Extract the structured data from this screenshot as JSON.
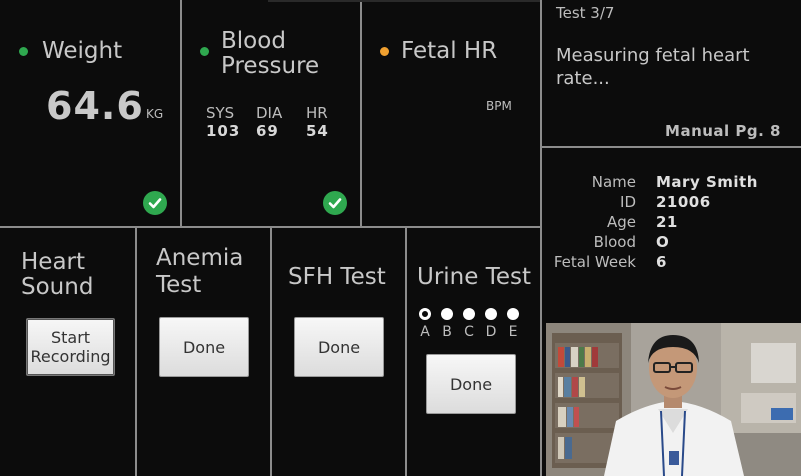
{
  "weight": {
    "title": "Weight",
    "value": "64.6",
    "unit": "KG",
    "status_color": "#2fa84f"
  },
  "blood_pressure": {
    "title_line1": "Blood",
    "title_line2": "Pressure",
    "sys_label": "SYS",
    "dia_label": "DIA",
    "hr_label": "HR",
    "sys_value": "103",
    "dia_value": "69",
    "hr_value": "54",
    "status_color": "#2fa84f"
  },
  "fetal_hr": {
    "title": "Fetal HR",
    "unit": "BPM",
    "status_color": "#f0a030"
  },
  "status": {
    "test_counter": "Test 3/7",
    "message": "Measuring fetal heart rate...",
    "manual_ref": "Manual Pg. 8"
  },
  "patient": {
    "fields": [
      {
        "label": "Name",
        "value": "Mary Smith"
      },
      {
        "label": "ID",
        "value": "21006"
      },
      {
        "label": "Age",
        "value": "21"
      },
      {
        "label": "Blood",
        "value": "O"
      },
      {
        "label": "Fetal Week",
        "value": "6"
      }
    ]
  },
  "heart_sound": {
    "title_line1": "Heart",
    "title_line2": "Sound",
    "button_line1": "Start",
    "button_line2": "Recording"
  },
  "anemia": {
    "title_line1": "Anemia",
    "title_line2": "Test",
    "button": "Done"
  },
  "sfh": {
    "title": "SFH Test",
    "button": "Done"
  },
  "urine": {
    "title": "Urine Test",
    "options": [
      "A",
      "B",
      "C",
      "D",
      "E"
    ],
    "selected": "A",
    "button": "Done"
  },
  "colors": {
    "ok": "#2fa84f",
    "pending": "#f0a030",
    "background": "#0c0c0c",
    "divider": "#8c8c8c"
  }
}
